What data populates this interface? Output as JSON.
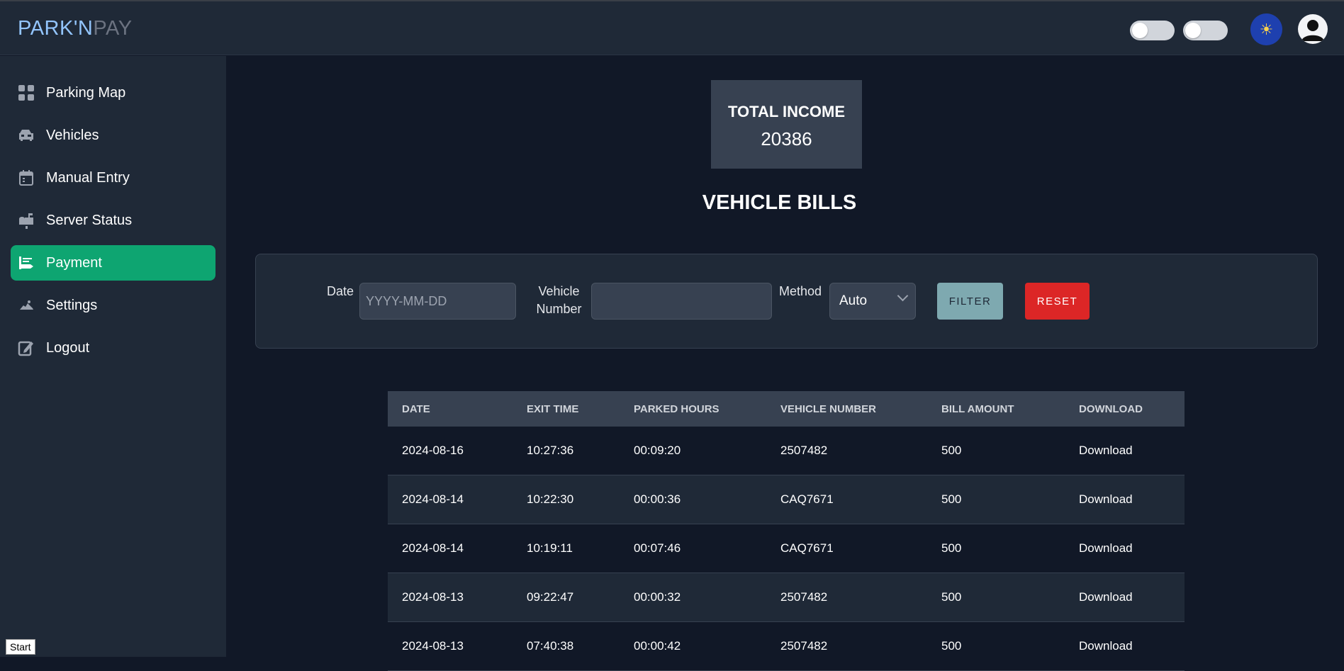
{
  "header": {
    "brand_part1": "PARK'N",
    "brand_part2": "PAY",
    "theme_icon": "sun-icon",
    "avatar_icon": "user-avatar-icon"
  },
  "sidebar": {
    "items": [
      {
        "label": "Parking Map",
        "icon": "grid-icon"
      },
      {
        "label": "Vehicles",
        "icon": "car-icon"
      },
      {
        "label": "Manual Entry",
        "icon": "calendar-icon"
      },
      {
        "label": "Server Status",
        "icon": "mailbox-icon"
      },
      {
        "label": "Payment",
        "icon": "payment-icon",
        "active": true
      },
      {
        "label": "Settings",
        "icon": "settings-icon"
      },
      {
        "label": "Logout",
        "icon": "logout-icon"
      }
    ]
  },
  "summary": {
    "title": "TOTAL INCOME",
    "value": "20386"
  },
  "main": {
    "title": "VEHICLE BILLS"
  },
  "filters": {
    "date_label": "Date",
    "date_placeholder": "YYYY-MM-DD",
    "vehicle_label_line1": "Vehicle",
    "vehicle_label_line2": "Number",
    "vehicle_value": "",
    "method_label": "Method",
    "method_value": "Auto",
    "filter_button": "FILTER",
    "reset_button": "RESET"
  },
  "table": {
    "headers": [
      "DATE",
      "EXIT TIME",
      "PARKED HOURS",
      "VEHICLE NUMBER",
      "BILL AMOUNT",
      "DOWNLOAD"
    ],
    "rows": [
      [
        "2024-08-16",
        "10:27:36",
        "00:09:20",
        "2507482",
        "500",
        "Download"
      ],
      [
        "2024-08-14",
        "10:22:30",
        "00:00:36",
        "CAQ7671",
        "500",
        "Download"
      ],
      [
        "2024-08-14",
        "10:19:11",
        "00:07:46",
        "CAQ7671",
        "500",
        "Download"
      ],
      [
        "2024-08-13",
        "09:22:47",
        "00:00:32",
        "2507482",
        "500",
        "Download"
      ],
      [
        "2024-08-13",
        "07:40:38",
        "00:00:42",
        "2507482",
        "500",
        "Download"
      ]
    ]
  },
  "taskbar": {
    "start_label": "Start"
  },
  "colors": {
    "accent": "#0ea571",
    "reset": "#dc2626",
    "filter": "#7ea9b0",
    "background": "#111827",
    "panel": "#1f2937"
  }
}
